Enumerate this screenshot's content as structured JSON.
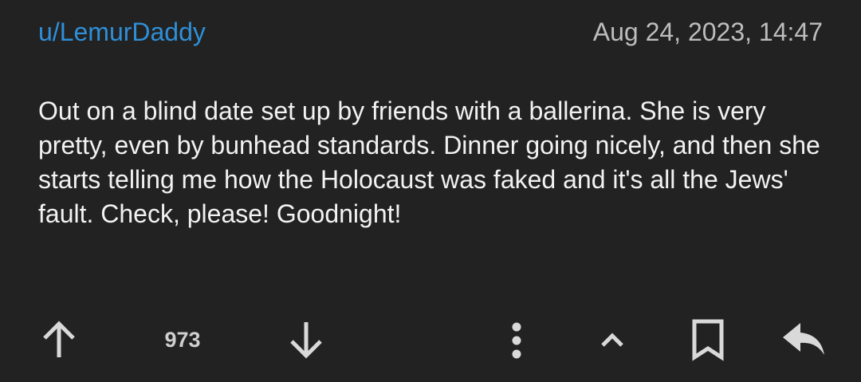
{
  "comment": {
    "author": "u/LemurDaddy",
    "timestamp": "Aug 24, 2023, 14:47",
    "body": "Out on a blind date set up by friends with a ballerina. She is very pretty, even by bunhead standards. Dinner going nicely, and then she starts telling me how the Holocaust was faked and it's all the Jews' fault. Check, please! Goodnight!",
    "score": "973"
  },
  "actions": {
    "upvote_icon": "arrow-up-icon",
    "downvote_icon": "arrow-down-icon",
    "more_icon": "more-vertical-icon",
    "collapse_icon": "chevron-up-icon",
    "save_icon": "bookmark-icon",
    "reply_icon": "reply-icon"
  },
  "colors": {
    "background": "#222222",
    "username": "#2f8fd8",
    "timestamp": "#bdbdbd",
    "text": "#f2f2f2",
    "icon": "#d9d9d9"
  }
}
